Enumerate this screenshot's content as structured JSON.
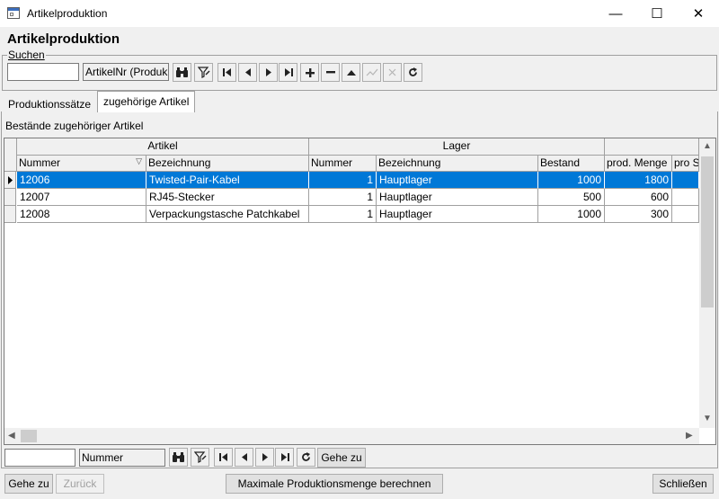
{
  "window": {
    "title": "Artikelproduktion",
    "minimize_glyph": "—",
    "maximize_glyph": "☐",
    "close_glyph": "✕"
  },
  "page_title": "Artikelproduktion",
  "search": {
    "legend": "Suchen",
    "value": "",
    "field_combo": "ArtikelNr (Produk"
  },
  "toolbar_icons": [
    "binoculars-icon",
    "filter-icon",
    "first-icon",
    "prev-icon",
    "next-icon",
    "last-icon",
    "plus-icon",
    "minus-icon",
    "up-icon",
    "check-icon",
    "cancel-icon",
    "refresh-icon"
  ],
  "tabs": [
    {
      "label": "Produktionssätze",
      "active": false
    },
    {
      "label": "zugehörige Artikel",
      "active": true
    }
  ],
  "section_label": "Bestände zugehöriger Artikel",
  "grid": {
    "group_headers": [
      "Artikel",
      "Lager",
      ""
    ],
    "columns": [
      "Nummer",
      "Bezeichnung",
      "Nummer",
      "Bezeichnung",
      "Bestand",
      "prod. Menge",
      "pro S"
    ],
    "rows": [
      {
        "selected": true,
        "cells": [
          "12006",
          "Twisted-Pair-Kabel",
          "1",
          "Hauptlager",
          "1000",
          "1800",
          ""
        ]
      },
      {
        "selected": false,
        "cells": [
          "12007",
          "RJ45-Stecker",
          "1",
          "Hauptlager",
          "500",
          "600",
          ""
        ]
      },
      {
        "selected": false,
        "cells": [
          "12008",
          "Verpackungstasche Patchkabel",
          "1",
          "Hauptlager",
          "1000",
          "300",
          ""
        ]
      }
    ]
  },
  "nav": {
    "value": "",
    "field_combo": "Nummer",
    "goto_label": "Gehe zu"
  },
  "footer": {
    "goto_label": "Gehe zu",
    "back_label": "Zurück",
    "calc_label": "Maximale Produktionsmenge berechnen",
    "close_label": "Schließen"
  },
  "colors": {
    "selection": "#0078d7",
    "window_bg": "#f0f0f0"
  }
}
